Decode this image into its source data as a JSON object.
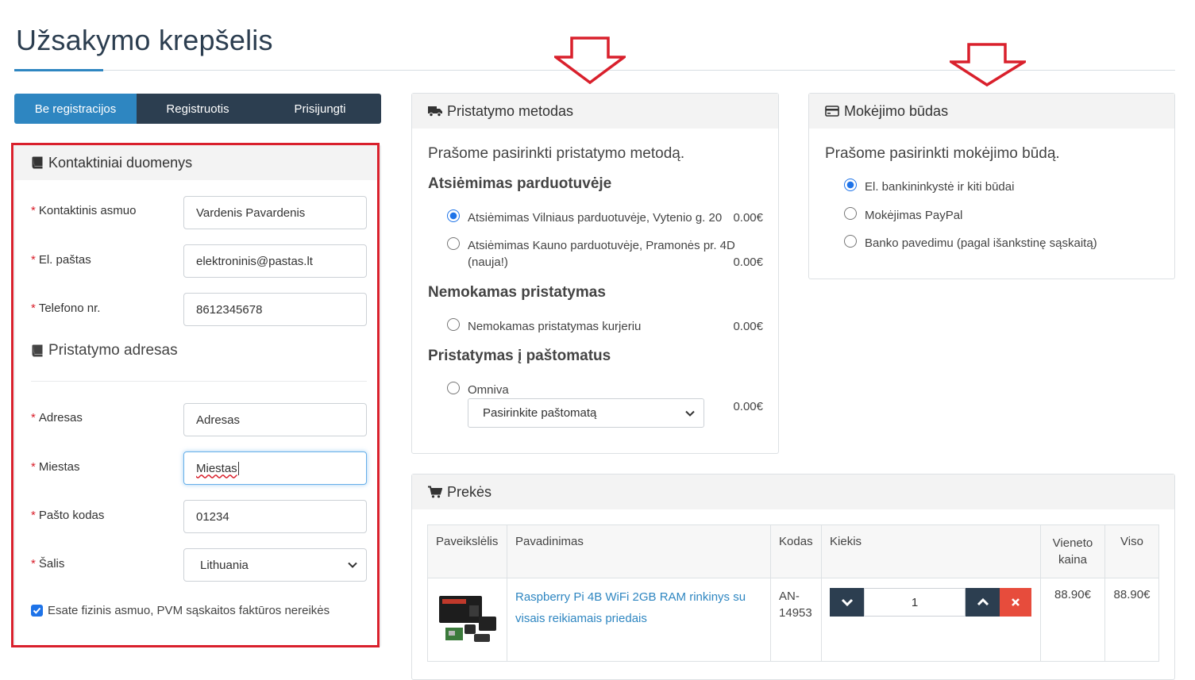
{
  "page": {
    "title": "Užsakymo krepšelis"
  },
  "tabs": [
    {
      "label": "Be registracijos",
      "active": true
    },
    {
      "label": "Registruotis",
      "active": false
    },
    {
      "label": "Prisijungti",
      "active": false
    }
  ],
  "contact": {
    "heading": "Kontaktiniai duomenys",
    "fields": {
      "name": {
        "label": "Kontaktinis asmuo",
        "value": "Vardenis Pavardenis"
      },
      "email": {
        "label": "El. paštas",
        "value": "elektroninis@pastas.lt"
      },
      "phone": {
        "label": "Telefono nr.",
        "value": "8612345678"
      }
    },
    "required_mark": "*"
  },
  "address": {
    "heading": "Pristatymo adresas",
    "fields": {
      "street": {
        "label": "Adresas",
        "value": "Adresas"
      },
      "city": {
        "label": "Miestas",
        "value": "Miestas"
      },
      "postal": {
        "label": "Pašto kodas",
        "value": "01234"
      },
      "country": {
        "label": "Šalis",
        "value": "Lithuania"
      }
    },
    "individual_checkbox": {
      "label": "Esate fizinis asmuo, PVM sąskaitos faktūros nereikės",
      "checked": true
    }
  },
  "delivery": {
    "heading": "Pristatymo metodas",
    "lead": "Prašome pasirinkti pristatymo metodą.",
    "groups": [
      {
        "title": "Atsiėmimas parduotuvėje",
        "options": [
          {
            "label": "Atsiėmimas Vilniaus parduotuvėje, Vytenio g. 20",
            "price": "0.00€",
            "selected": true
          },
          {
            "label": "Atsiėmimas Kauno parduotuvėje, Pramonės pr. 4D",
            "label2": "(nauja!)",
            "price": "0.00€",
            "selected": false
          }
        ]
      },
      {
        "title": "Nemokamas pristatymas",
        "options": [
          {
            "label": "Nemokamas pristatymas kurjeriu",
            "price": "0.00€",
            "selected": false
          }
        ]
      },
      {
        "title": "Pristatymas į paštomatus",
        "options": [
          {
            "label": "Omniva",
            "price": "0.00€",
            "selected": false,
            "select_value": "Pasirinkite paštomatą"
          }
        ]
      }
    ]
  },
  "payment": {
    "heading": "Mokėjimo būdas",
    "lead": "Prašome pasirinkti mokėjimo būdą.",
    "options": [
      {
        "label": "El. bankininkystė ir kiti būdai",
        "selected": true
      },
      {
        "label": "Mokėjimas PayPal",
        "selected": false
      },
      {
        "label": "Banko pavedimu (pagal išankstinę sąskaitą)",
        "selected": false
      }
    ]
  },
  "products": {
    "heading": "Prekės",
    "columns": [
      "Paveikslėlis",
      "Pavadinimas",
      "Kodas",
      "Kiekis",
      "Vieneto kaina",
      "Viso"
    ],
    "rows": [
      {
        "name": "Raspberry Pi 4B WiFi 2GB RAM rinkinys su visais reikiamais priedais",
        "code": "AN-14953",
        "qty": "1",
        "unit_price": "88.90€",
        "total": "88.90€"
      }
    ]
  },
  "colors": {
    "accent": "#2e86c1",
    "nav_dark": "#2c3e50",
    "highlight_red": "#d9202c",
    "danger": "#e74c3c"
  }
}
